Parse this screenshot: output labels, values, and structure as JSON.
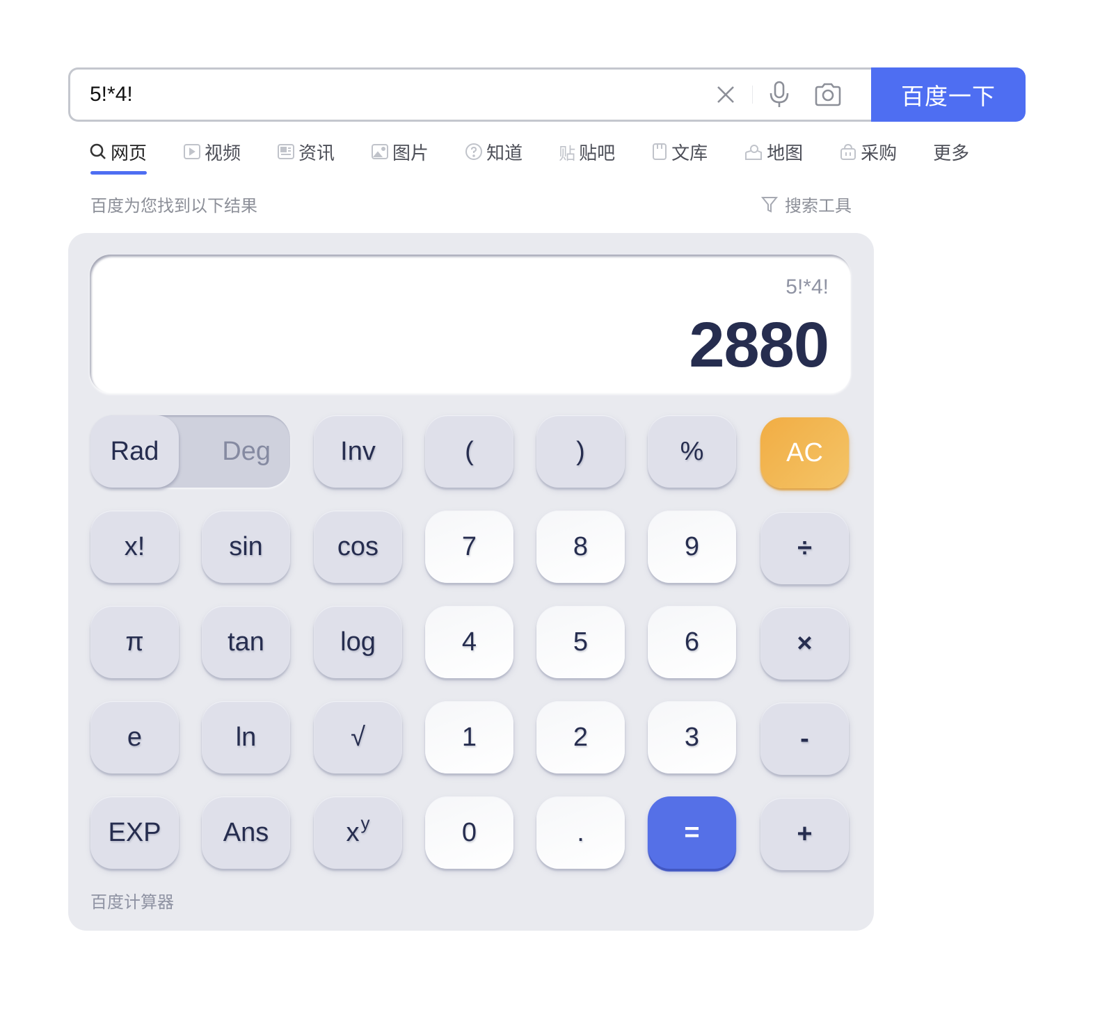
{
  "search": {
    "query": "5!*4!",
    "button_label": "百度一下",
    "icons": [
      "clear-icon",
      "microphone-icon",
      "camera-icon"
    ]
  },
  "tabs": [
    {
      "label": "网页",
      "icon": "search-icon",
      "active": true
    },
    {
      "label": "视频",
      "icon": "video-icon",
      "active": false
    },
    {
      "label": "资讯",
      "icon": "news-icon",
      "active": false
    },
    {
      "label": "图片",
      "icon": "image-icon",
      "active": false
    },
    {
      "label": "知道",
      "icon": "question-icon",
      "active": false
    },
    {
      "label": "贴吧",
      "icon": "tieba-icon",
      "active": false
    },
    {
      "label": "文库",
      "icon": "doc-icon",
      "active": false
    },
    {
      "label": "地图",
      "icon": "map-icon",
      "active": false
    },
    {
      "label": "采购",
      "icon": "basket-icon",
      "active": false
    },
    {
      "label": "更多",
      "icon": null,
      "active": false
    }
  ],
  "results_info": {
    "found_text": "百度为您找到以下结果",
    "tools_label": "搜索工具"
  },
  "colors": {
    "accent": "#4e6ef2",
    "equals": "#5570e7",
    "clear": "#f2b24d",
    "display_text": "#262d4f",
    "card_bg": "#e9eaef"
  },
  "calculator": {
    "expression": "5!*4!",
    "result": "2880",
    "angle_mode": {
      "options": [
        "Rad",
        "Deg"
      ],
      "selected": "Rad"
    },
    "keys": {
      "row1": [
        "Inv",
        "(",
        ")",
        "%",
        "AC"
      ],
      "row2": [
        "x!",
        "sin",
        "cos",
        "7",
        "8",
        "9",
        "÷"
      ],
      "row3": [
        "π",
        "tan",
        "log",
        "4",
        "5",
        "6",
        "×"
      ],
      "row4": [
        "e",
        "ln",
        "√",
        "1",
        "2",
        "3",
        "-"
      ],
      "row5": [
        "EXP",
        "Ans",
        "x",
        "0",
        ".",
        "=",
        "+"
      ],
      "xy_superscript": "y"
    },
    "footer": "百度计算器"
  }
}
